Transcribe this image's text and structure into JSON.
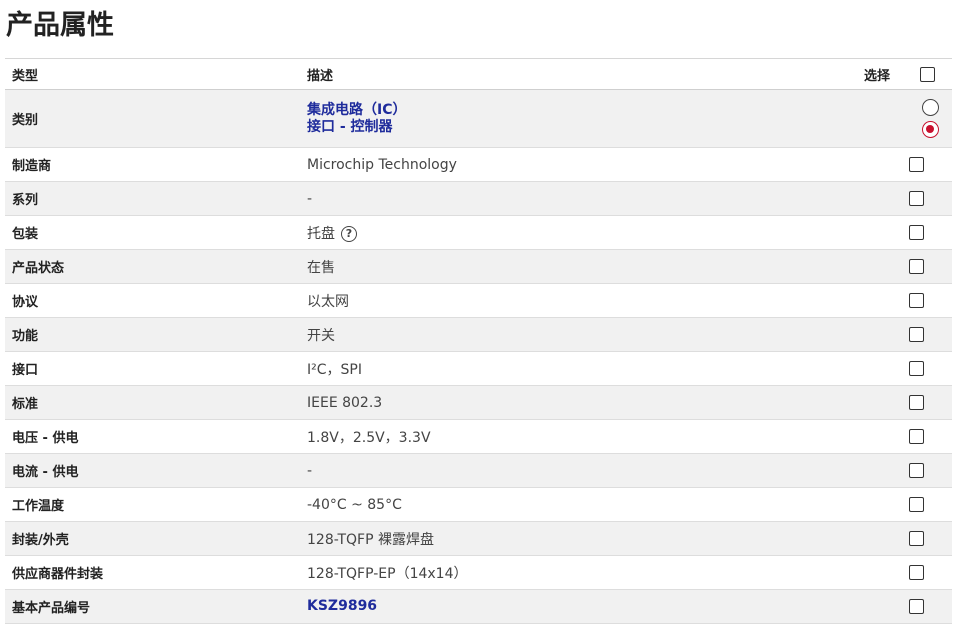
{
  "page": {
    "title": "产品属性"
  },
  "table": {
    "headers": {
      "type": "类型",
      "description": "描述",
      "select": "选择"
    },
    "rows": [
      {
        "type": "类别",
        "values": [
          "集成电路（IC）",
          "接口 - 控制器"
        ],
        "links": true,
        "control": "radio",
        "radio_selected": 1
      },
      {
        "type": "制造商",
        "values": [
          "Microchip Technology"
        ],
        "links": false,
        "control": "checkbox"
      },
      {
        "type": "系列",
        "values": [
          "-"
        ],
        "links": false,
        "control": "checkbox"
      },
      {
        "type": "包装",
        "values": [
          "托盘"
        ],
        "links": false,
        "control": "checkbox",
        "help_icon": "question-circle-icon"
      },
      {
        "type": "产品状态",
        "values": [
          "在售"
        ],
        "links": false,
        "control": "checkbox"
      },
      {
        "type": "协议",
        "values": [
          "以太网"
        ],
        "links": false,
        "control": "checkbox"
      },
      {
        "type": "功能",
        "values": [
          "开关"
        ],
        "links": false,
        "control": "checkbox"
      },
      {
        "type": "接口",
        "values": [
          "I²C，SPI"
        ],
        "links": false,
        "control": "checkbox"
      },
      {
        "type": "标准",
        "values": [
          "IEEE 802.3"
        ],
        "links": false,
        "control": "checkbox"
      },
      {
        "type": "电压 - 供电",
        "values": [
          "1.8V，2.5V，3.3V"
        ],
        "links": false,
        "control": "checkbox"
      },
      {
        "type": "电流 - 供电",
        "values": [
          "-"
        ],
        "links": false,
        "control": "checkbox"
      },
      {
        "type": "工作温度",
        "values": [
          "-40°C ~ 85°C"
        ],
        "links": false,
        "control": "checkbox"
      },
      {
        "type": "封装/外壳",
        "values": [
          "128-TQFP 裸露焊盘"
        ],
        "links": false,
        "control": "checkbox"
      },
      {
        "type": "供应商器件封装",
        "values": [
          "128-TQFP-EP（14x14）"
        ],
        "links": false,
        "control": "checkbox"
      },
      {
        "type": "基本产品编号",
        "values": [
          "KSZ9896"
        ],
        "links": true,
        "control": "checkbox"
      }
    ]
  },
  "colors": {
    "link": "#1f2c9c",
    "radio_selected": "#c8102e",
    "row_stripe": "#f1f1f1"
  }
}
